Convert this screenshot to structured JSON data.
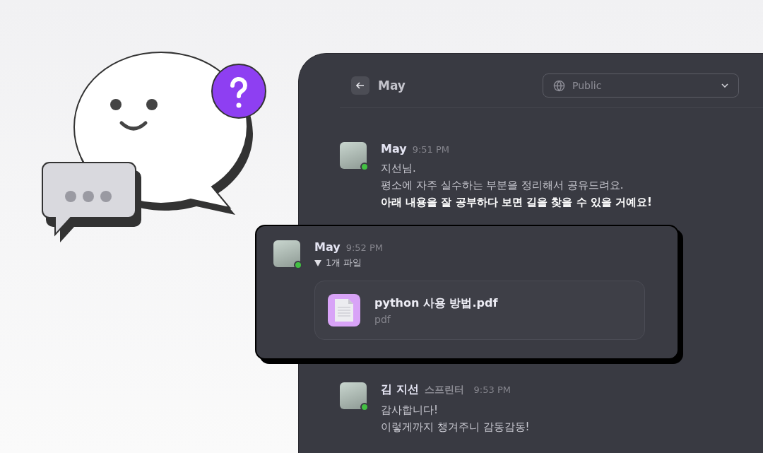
{
  "header": {
    "title": "May",
    "visibility": {
      "label": "Public",
      "open": false
    }
  },
  "messages": [
    {
      "kind": "text",
      "highlighted": false,
      "author": "May",
      "time": "9:51 PM",
      "online": true,
      "lines": [
        {
          "text": "지선님.",
          "bold": false
        },
        {
          "text": "평소에 자주 실수하는 부분을 정리해서 공유드려요.",
          "bold": false
        },
        {
          "text": "아래 내용을 잘 공부하다 보면 길을 찾을 수 있을 거예요!",
          "bold": true
        }
      ]
    },
    {
      "kind": "file",
      "highlighted": true,
      "author": "May",
      "time": "9:52 PM",
      "online": true,
      "files_toggle": {
        "label": "1개 파일",
        "expanded": true
      },
      "file": {
        "name": "python 사용 방법.pdf",
        "type": "pdf"
      }
    },
    {
      "kind": "text",
      "highlighted": false,
      "author": "김 지선",
      "role": "스프린터",
      "time": "9:53 PM",
      "online": true,
      "lines": [
        {
          "text": "감사합니다!",
          "bold": false
        },
        {
          "text": "이렇게까지 챙겨주니 감동감동!",
          "bold": false
        }
      ]
    }
  ]
}
